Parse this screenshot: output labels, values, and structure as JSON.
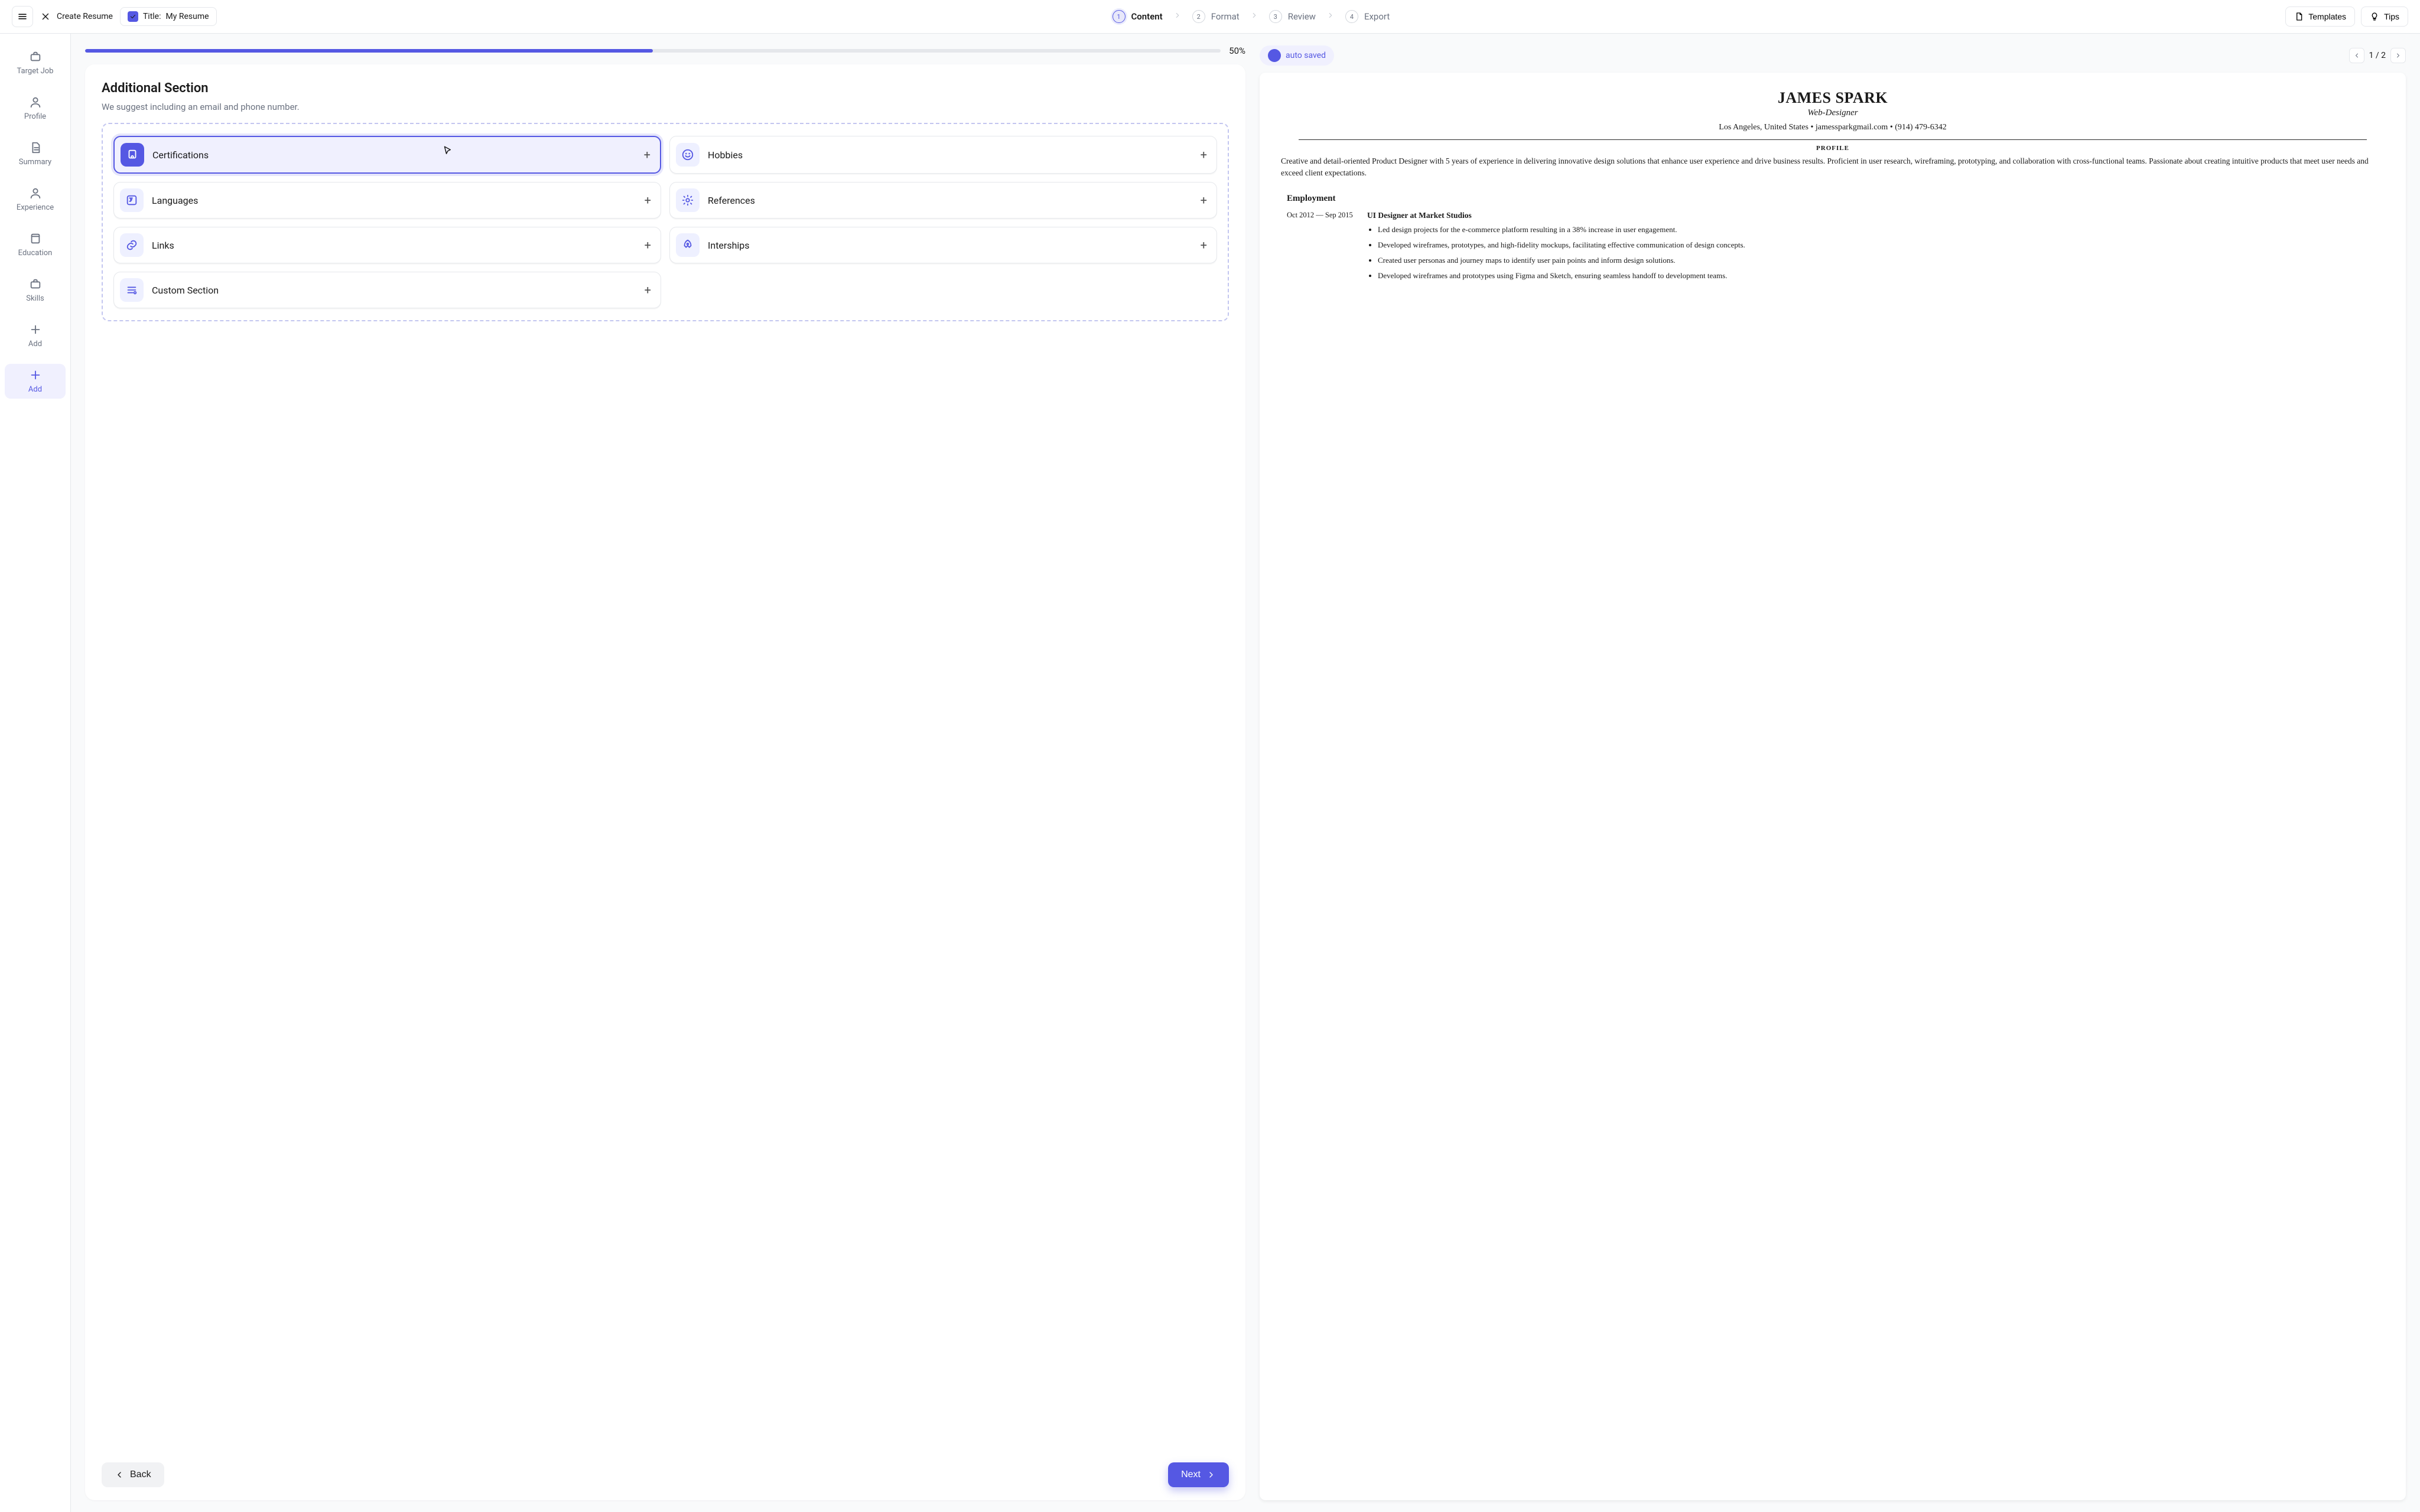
{
  "header": {
    "close_label": "Create Resume",
    "title_prefix": "Title:",
    "title_value": "My Resume",
    "templates_label": "Templates",
    "tips_label": "Tips"
  },
  "breadcrumb": [
    {
      "num": "1",
      "label": "Content",
      "active": true
    },
    {
      "num": "2",
      "label": "Format",
      "active": false
    },
    {
      "num": "3",
      "label": "Review",
      "active": false
    },
    {
      "num": "4",
      "label": "Export",
      "active": false
    }
  ],
  "sidebar": [
    {
      "label": "Target Job",
      "icon": "briefcase"
    },
    {
      "label": "Profile",
      "icon": "user"
    },
    {
      "label": "Summary",
      "icon": "doc"
    },
    {
      "label": "Experience",
      "icon": "user"
    },
    {
      "label": "Education",
      "icon": "book"
    },
    {
      "label": "Skills",
      "icon": "briefcase"
    },
    {
      "label": "Add",
      "icon": "plus"
    },
    {
      "label": "Add",
      "icon": "plus",
      "active": true
    }
  ],
  "progress": {
    "percent": 50,
    "label": "50%"
  },
  "autosave_label": "auto saved",
  "pager": {
    "current": 1,
    "total": 2,
    "text": "1 / 2"
  },
  "editor": {
    "title": "Additional Section",
    "subtitle": "We suggest including an email and phone number.",
    "back_label": "Back",
    "next_label": "Next",
    "chips": [
      {
        "id": "certifications",
        "label": "Certifications",
        "icon": "badge",
        "selected": true
      },
      {
        "id": "hobbies",
        "label": "Hobbies",
        "icon": "smile"
      },
      {
        "id": "languages",
        "label": "Languages",
        "icon": "lang"
      },
      {
        "id": "references",
        "label": "References",
        "icon": "gear"
      },
      {
        "id": "links",
        "label": "Links",
        "icon": "link"
      },
      {
        "id": "internships",
        "label": "Interships",
        "icon": "rocket"
      },
      {
        "id": "custom",
        "label": "Custom Section",
        "icon": "custom"
      }
    ]
  },
  "resume": {
    "name": "JAMES SPARK",
    "role": "Web-Designer",
    "contact": "Los Angeles, United States • jamessparkgmail.com • (914) 479-6342",
    "profile_heading": "PROFILE",
    "profile_text": "Creative and detail-oriented Product Designer with 5 years of experience in delivering innovative design solutions that enhance user experience and drive business results. Proficient in user research, wireframing, prototyping, and collaboration with cross-functional teams. Passionate about creating intuitive products that meet user needs and exceed client expectations.",
    "employment_heading": "Employment",
    "job": {
      "dates": "Oct 2012 — Sep 2015",
      "title": "UI Designer at Market Studios",
      "bullets": [
        "Led design projects for the e-commerce platform resulting in a 38% increase in user engagement.",
        "Developed wireframes, prototypes, and high-fidelity mockups, facilitating effective communication of design concepts.",
        "Created user personas and journey maps to identify user pain points and inform design solutions.",
        "Developed wireframes and prototypes using Figma and Sketch, ensuring seamless handoff to development teams."
      ]
    }
  }
}
